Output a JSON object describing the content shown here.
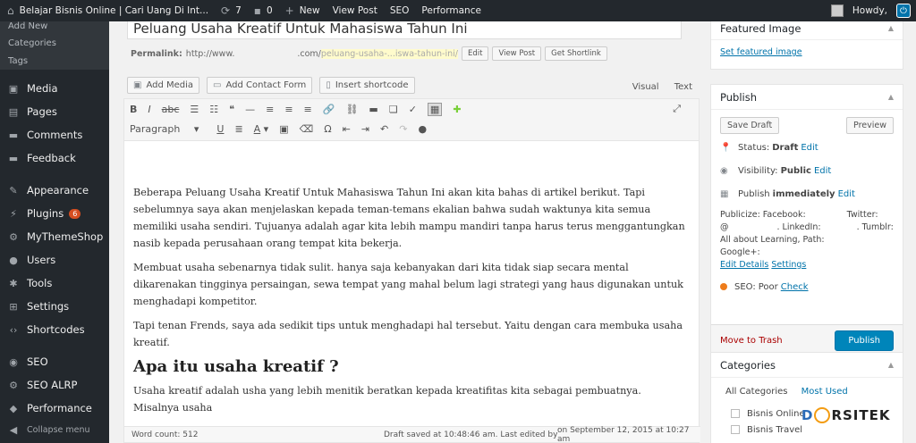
{
  "adminbar": {
    "site": "Belajar Bisnis Online | Cari Uang Di Int...",
    "updates": "7",
    "comments": "0",
    "new": "New",
    "view_post": "View Post",
    "seo": "SEO",
    "performance": "Performance",
    "howdy": "Howdy,"
  },
  "sidebar": {
    "sub_items": [
      "Add New",
      "Categories",
      "Tags"
    ],
    "items": [
      {
        "label": "Media",
        "icon": "media-icon"
      },
      {
        "label": "Pages",
        "icon": "pages-icon"
      },
      {
        "label": "Comments",
        "icon": "comments-icon"
      },
      {
        "label": "Feedback",
        "icon": "feedback-icon"
      },
      {
        "label": "Appearance",
        "icon": "appearance-icon"
      },
      {
        "label": "Plugins",
        "icon": "plugins-icon",
        "badge": "6"
      },
      {
        "label": "MyThemeShop",
        "icon": "mythemeshop-icon"
      },
      {
        "label": "Users",
        "icon": "users-icon"
      },
      {
        "label": "Tools",
        "icon": "tools-icon"
      },
      {
        "label": "Settings",
        "icon": "settings-icon"
      },
      {
        "label": "Shortcodes",
        "icon": "shortcodes-icon"
      },
      {
        "label": "SEO",
        "icon": "seo-icon"
      },
      {
        "label": "SEO ALRP",
        "icon": "seo-alrp-icon"
      },
      {
        "label": "Performance",
        "icon": "performance-icon"
      },
      {
        "label": "Collapse menu",
        "icon": "collapse-icon"
      }
    ]
  },
  "editor": {
    "title": "Peluang Usaha Kreatif Untuk Mahasiswa Tahun Ini",
    "permalink_label": "Permalink:",
    "permalink_start": "http://www.",
    "permalink_mid": ".com/",
    "permalink_slug": "peluang-usaha-...iswa-tahun-ini/",
    "edit": "Edit",
    "view_post": "View Post",
    "get_shortlink": "Get Shortlink",
    "add_media": "Add Media",
    "add_contact_form": "Add Contact Form",
    "insert_shortcode": "Insert shortcode",
    "tab_visual": "Visual",
    "tab_text": "Text",
    "format_select": "Paragraph",
    "paragraphs": [
      "Beberapa Peluang Usaha Kreatif Untuk Mahasiswa Tahun Ini akan kita bahas di artikel berikut. Tapi sebelumnya saya akan menjelaskan kepada teman-temans ekalian bahwa sudah waktunya kita semua memiliki usaha sendiri. Tujuanya adalah agar kita lebih mampu mandiri tanpa harus terus menggantungkan nasib kepada perusahaan orang tempat kita bekerja.",
      "Membuat usaha sebenarnya tidak sulit. hanya saja kebanyakan dari kita tidak siap secara mental dikarenakan tingginya persaingan, sewa tempat yang mahal belum lagi strategi yang haus digunakan untuk menghadapi kompetitor.",
      "Tapi tenan Frends, saya ada sedikit tips untuk menghadapi hal tersebut. Yaitu dengan cara membuka usaha kreatif."
    ],
    "heading": "Apa itu usaha kreatif ?",
    "paragraph_last": "Usaha kreatif adalah usha yang lebih menitik beratkan kepada kreatifitas kita sebagai pembuatnya. Misalnya usaha",
    "word_count": "Word count: 512",
    "draft_saved": "Draft saved at 10:48:46 am. Last edited by",
    "last_edited_date": "on September 12, 2015 at 10:27 am"
  },
  "featured_image": {
    "title": "Featured Image",
    "link": "Set featured image"
  },
  "publish": {
    "title": "Publish",
    "save_draft": "Save Draft",
    "preview": "Preview",
    "status_label": "Status:",
    "status_value": "Draft",
    "visibility_label": "Visibility:",
    "visibility_value": "Public",
    "publish_label": "Publish",
    "publish_value": "immediately",
    "edit": "Edit",
    "publicize_line1": "Publicize: Facebook:",
    "publicize_twitter": "Twitter:",
    "publicize_line2": "@",
    "publicize_linkedin": ". LinkedIn:",
    "publicize_tumblr": ". Tumblr:",
    "publicize_line3": "All about Learning, Path:",
    "publicize_line4": "Google+:",
    "edit_details": "Edit Details",
    "settings": "Settings",
    "seo_label": "SEO:",
    "seo_value": "Poor",
    "check": "Check",
    "move_to_trash": "Move to Trash",
    "publish_button": "Publish"
  },
  "categories": {
    "title": "Categories",
    "tab_all": "All Categories",
    "tab_most_used": "Most Used",
    "items": [
      "Bisnis Online",
      "Bisnis Travel"
    ]
  },
  "watermark": {
    "d": "D",
    "rest": "RSITEK"
  }
}
